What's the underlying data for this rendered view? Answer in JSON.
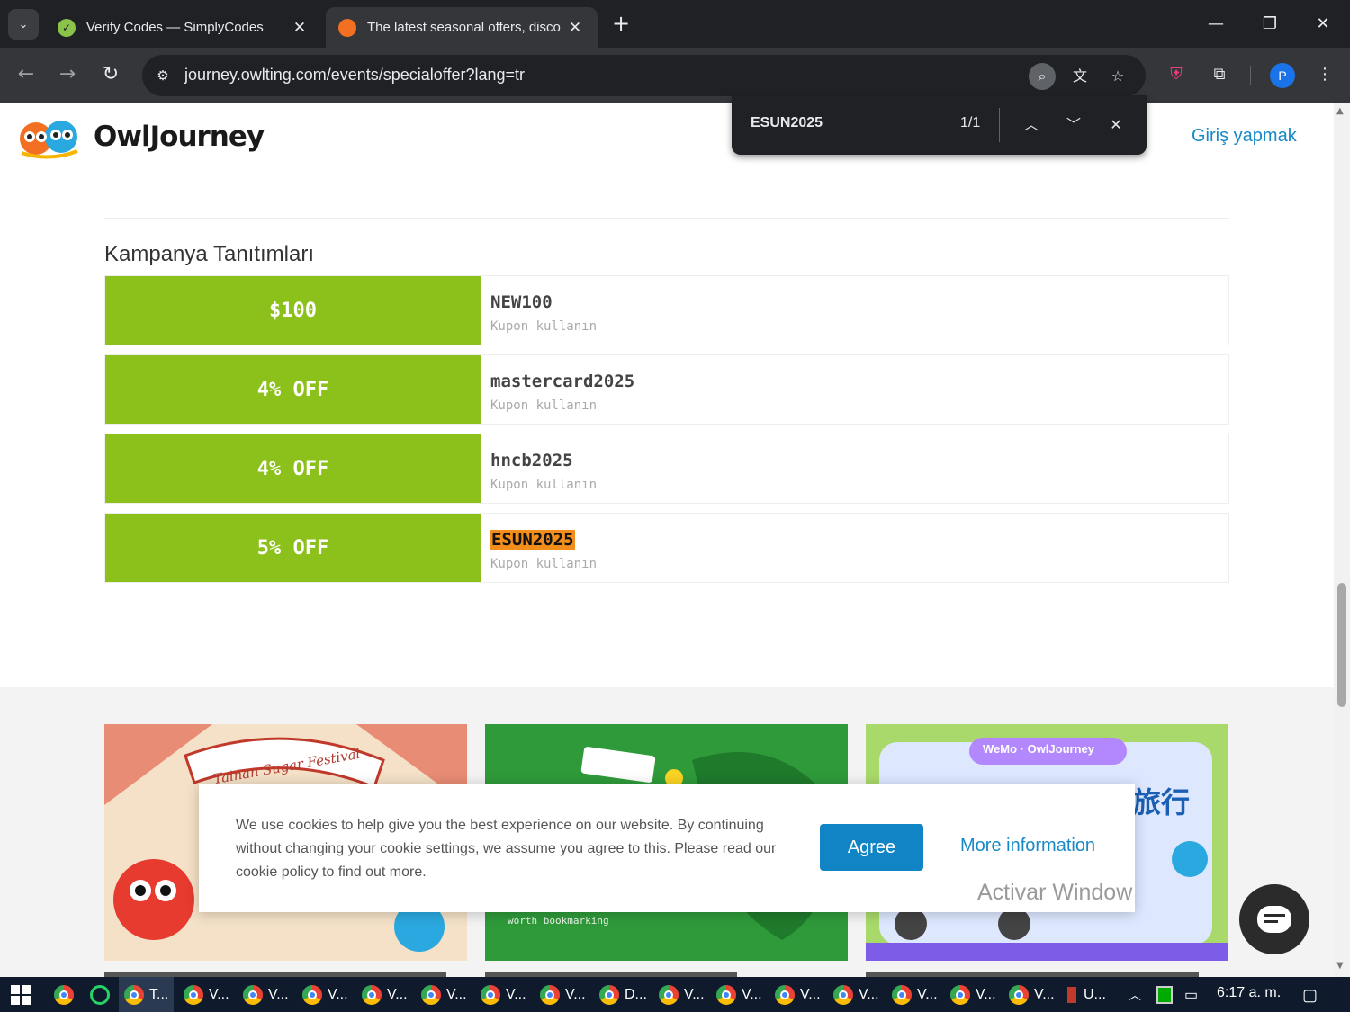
{
  "browser": {
    "tabs": [
      {
        "title": "Verify Codes — SimplyCodes",
        "active": false
      },
      {
        "title": "The latest seasonal offers, disco",
        "active": true
      }
    ],
    "url": "journey.owlting.com/events/specialoffer?lang=tr",
    "profile_initial": "P"
  },
  "findbar": {
    "query": "ESUN2025",
    "count": "1/1"
  },
  "header": {
    "brand": "OwlJourney",
    "login": "Giriş yapmak"
  },
  "section": {
    "title": "Kampanya Tanıtımları"
  },
  "coupons": [
    {
      "amount": "$100",
      "code": "NEW100",
      "action": "Kupon kullanın",
      "highlighted": false
    },
    {
      "amount": "4% OFF",
      "code": "mastercard2025",
      "action": "Kupon kullanın",
      "highlighted": false
    },
    {
      "amount": "4% OFF",
      "code": "hncb2025",
      "action": "Kupon kullanın",
      "highlighted": false
    },
    {
      "amount": "5% OFF",
      "code": "ESUN2025",
      "action": "Kupon kullanın",
      "highlighted": true
    }
  ],
  "cards": [
    {
      "image_text": "Tainan Sugar Festival"
    },
    {
      "image_text": "worth bookmarking"
    },
    {
      "image_text": "WeMo · OwlJourney",
      "side_text": "旅行"
    }
  ],
  "cookie": {
    "text": "We use cookies to help give you the best experience on our website. By continuing without changing your cookie settings, we assume you agree to this. Please read our cookie policy to find out more.",
    "agree": "Agree",
    "more": "More information"
  },
  "watermark": "Activar Window",
  "taskbar": {
    "items": [
      "T...",
      "V...",
      "V...",
      "V...",
      "V...",
      "V...",
      "V...",
      "V...",
      "D...",
      "V...",
      "V...",
      "V...",
      "V...",
      "V...",
      "V...",
      "V...",
      "U..."
    ],
    "clock": "6:17 a. m."
  },
  "colors": {
    "coupon_green": "#8bc11a",
    "accent_blue": "#1689c6",
    "highlight": "#f38e1c"
  }
}
